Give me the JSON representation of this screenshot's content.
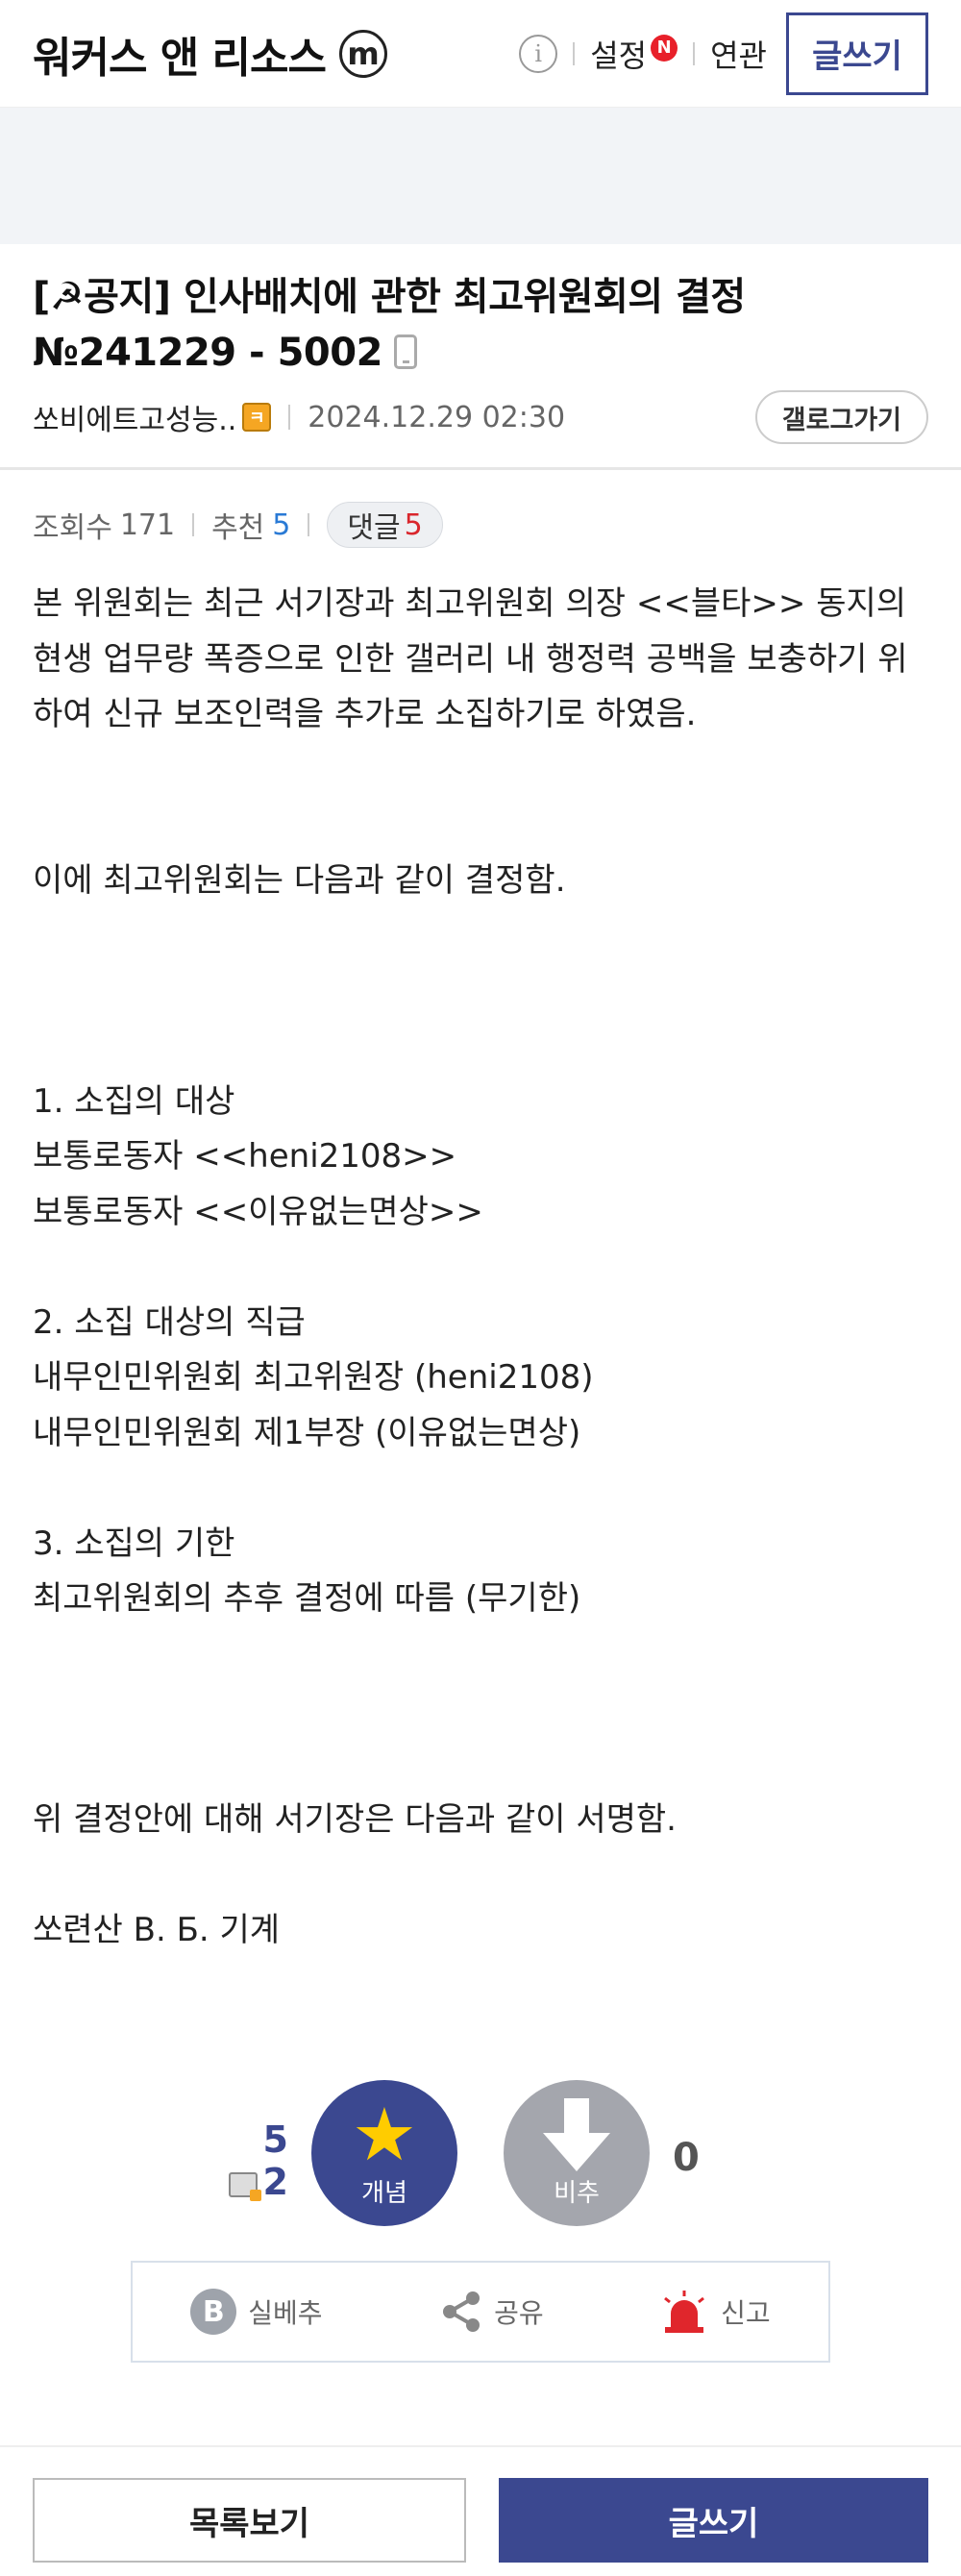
{
  "header": {
    "gallery_title": "워커스 앤 리소스",
    "m_badge": "m",
    "info_label": "i",
    "settings_label": "설정",
    "new_badge": "N",
    "related_label": "연관",
    "write_label": "글쓰기"
  },
  "post": {
    "title": "[☭공지] 인사배치에 관한 최고위원회의 결정 №241229 - 5002",
    "author": "쏘비에트고성능..",
    "author_badge": "ㅋ",
    "date": "2024.12.29 02:30",
    "gallog_label": "갤로그가기",
    "views_label": "조회수",
    "views": "171",
    "recommend_label": "추천",
    "recommend": "5",
    "comment_label": "댓글",
    "comment_count": "5",
    "body": [
      "본 위원회는 최근 서기장과 최고위원회 의장 <<블타>> 동지의 현생 업무량 폭증으로 인한 갤러리 내 행정력 공백을 보충하기 위하여 신규 보조인력을 추가로 소집하기로 하였음.",
      "",
      "",
      "이에 최고위원회는 다음과 같이 결정함.",
      "",
      "",
      "",
      "1. 소집의 대상",
      "보통로동자 <<heni2108>>",
      "보통로동자 <<이유없는면상>>",
      "",
      "2. 소집 대상의 직급",
      "내무인민위원회 최고위원장 (heni2108)",
      "내무인민위원회 제1부장 (이유없는면상)",
      "",
      "3. 소집의 기한",
      "최고위원회의 추후 결정에 따름 (무기한)",
      "",
      "",
      "",
      "위 결정안에 대해 서기장은 다음과 같이 서명함.",
      "",
      "쏘련산 В. Б. 기계"
    ]
  },
  "recommend": {
    "up_count": "5",
    "fixed_count": "2",
    "up_label": "개념",
    "down_label": "비추",
    "down_count": "0"
  },
  "actions": {
    "b_label": "B",
    "silbe_label": "실베추",
    "share_label": "공유",
    "report_label": "신고"
  },
  "bottom": {
    "list_label": "목록보기",
    "write_label": "글쓰기"
  },
  "colors": {
    "accent": "#3b4890",
    "new_badge": "#e8202a",
    "star": "#ffcc00",
    "comment_count": "#d9262c",
    "recommend_count": "#2a7ad5"
  }
}
